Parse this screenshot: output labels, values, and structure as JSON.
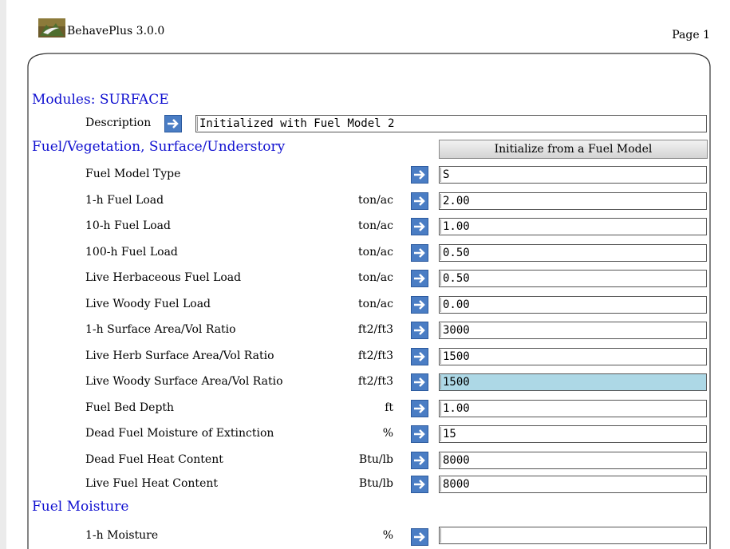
{
  "header": {
    "app_name": "BehavePlus 3.0.0",
    "page_label": "Page 1"
  },
  "modules_title": "Modules: SURFACE",
  "description": {
    "label": "Description",
    "value": "Initialized with Fuel Model 2"
  },
  "fuel_section": {
    "title": "Fuel/Vegetation, Surface/Understory",
    "init_button": "Initialize from a Fuel Model",
    "rows": [
      {
        "label": "Fuel Model Type",
        "unit": "",
        "value": "S"
      },
      {
        "label": "1-h Fuel Load",
        "unit": "ton/ac",
        "value": "2.00"
      },
      {
        "label": "10-h Fuel Load",
        "unit": "ton/ac",
        "value": "1.00"
      },
      {
        "label": "100-h Fuel Load",
        "unit": "ton/ac",
        "value": "0.50"
      },
      {
        "label": "Live Herbaceous Fuel Load",
        "unit": "ton/ac",
        "value": "0.50"
      },
      {
        "label": "Live Woody Fuel Load",
        "unit": "ton/ac",
        "value": "0.00"
      },
      {
        "label": "1-h Surface Area/Vol Ratio",
        "unit": "ft2/ft3",
        "value": "3000"
      },
      {
        "label": "Live Herb Surface Area/Vol Ratio",
        "unit": "ft2/ft3",
        "value": "1500"
      },
      {
        "label": "Live Woody Surface Area/Vol Ratio",
        "unit": "ft2/ft3",
        "value": "1500"
      },
      {
        "label": "Fuel Bed Depth",
        "unit": "ft",
        "value": "1.00"
      },
      {
        "label": "Dead Fuel Moisture of Extinction",
        "unit": "%",
        "value": "15"
      },
      {
        "label": "Dead Fuel Heat Content",
        "unit": "Btu/lb",
        "value": "8000"
      },
      {
        "label": "Live Fuel Heat Content",
        "unit": "Btu/lb",
        "value": "8000"
      }
    ]
  },
  "moisture_section": {
    "title": "Fuel Moisture",
    "rows": [
      {
        "label": "1-h Moisture",
        "unit": "%",
        "value": ""
      }
    ]
  },
  "colors": {
    "section_title": "#1010d0",
    "arrow_button": "#4a7dc4",
    "highlight": "#add8e6"
  },
  "icons": {
    "logo": "behaveplus-logo-icon",
    "arrow": "arrow-right-icon"
  }
}
